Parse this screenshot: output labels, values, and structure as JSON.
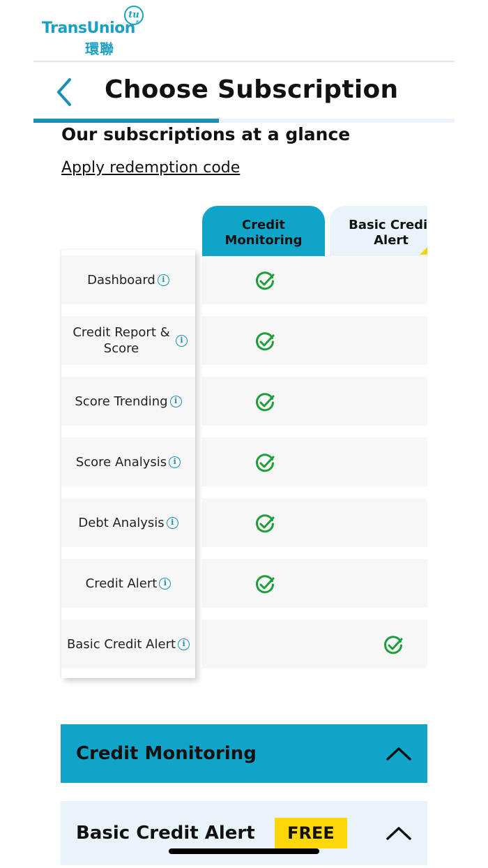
{
  "brand": {
    "name_en": "TransUnion",
    "mark": "tu",
    "name_zh": "環聯",
    "color": "#1aa0c2"
  },
  "header": {
    "title": "Choose Subscription",
    "back_icon": "chevron-left-icon",
    "progress": 0.44
  },
  "section": {
    "title": "Our subscriptions at a glance",
    "redeem_link": "Apply redemption code"
  },
  "comparison": {
    "columns": [
      "Credit Monitoring",
      "Basic Credit Alert"
    ],
    "rows": [
      {
        "feature": "Dashboard",
        "credit_monitoring": true,
        "basic_credit_alert": false
      },
      {
        "feature": "Credit Report & Score",
        "credit_monitoring": true,
        "basic_credit_alert": false
      },
      {
        "feature": "Score Trending",
        "credit_monitoring": true,
        "basic_credit_alert": false
      },
      {
        "feature": "Score Analysis",
        "credit_monitoring": true,
        "basic_credit_alert": false
      },
      {
        "feature": "Debt Analysis",
        "credit_monitoring": true,
        "basic_credit_alert": false
      },
      {
        "feature": "Credit Alert",
        "credit_monitoring": true,
        "basic_credit_alert": false
      },
      {
        "feature": "Basic Credit Alert",
        "credit_monitoring": false,
        "basic_credit_alert": true
      }
    ],
    "info_icon": "info-icon",
    "check_icon": "check-circle-icon"
  },
  "plans": [
    {
      "name": "Credit Monitoring",
      "badge": "",
      "expanded": true
    },
    {
      "name": "Basic Credit Alert",
      "badge": "FREE",
      "expanded": true
    }
  ],
  "colors": {
    "accent": "#0fa4c8",
    "accent_light": "#e8f4fa",
    "check_green": "#1e9e3a",
    "badge_yellow": "#ffd60a"
  }
}
